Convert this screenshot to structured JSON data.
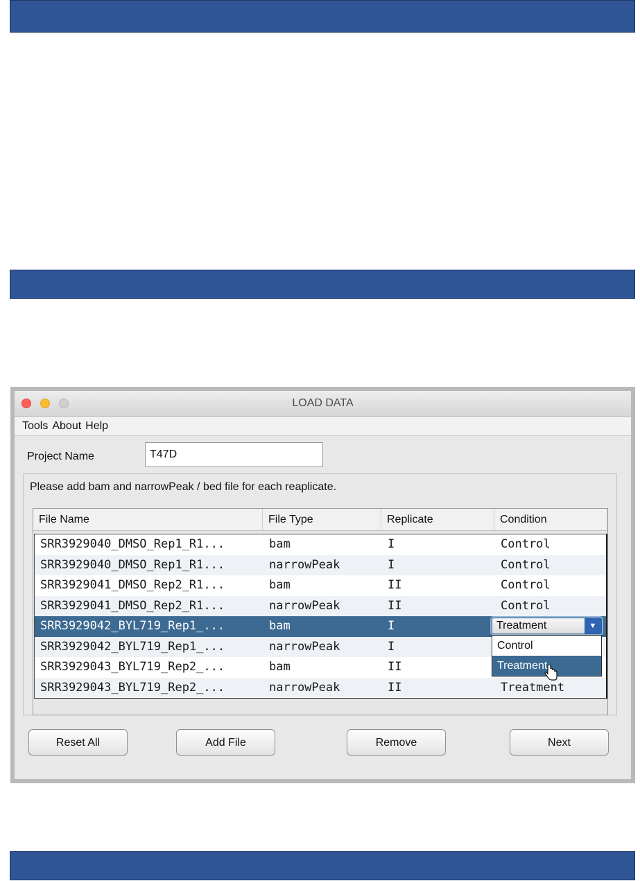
{
  "window": {
    "title": "LOAD DATA"
  },
  "menu": [
    "Tools",
    "About",
    "Help"
  ],
  "project": {
    "label": "Project Name",
    "value": "T47D"
  },
  "instructions": "Please add bam and narrowPeak / bed file for each reaplicate.",
  "table": {
    "headers": [
      "File Name",
      "File Type",
      "Replicate",
      "Condition"
    ],
    "rows": [
      [
        "SRR3929040_DMSO_Rep1_R1...",
        "bam",
        "I",
        "Control"
      ],
      [
        "SRR3929040_DMSO_Rep1_R1...",
        "narrowPeak",
        "I",
        "Control"
      ],
      [
        "SRR3929041_DMSO_Rep2_R1...",
        "bam",
        "II",
        "Control"
      ],
      [
        "SRR3929041_DMSO_Rep2_R1...",
        "narrowPeak",
        "II",
        "Control"
      ],
      [
        "SRR3929042_BYL719_Rep1_...",
        "bam",
        "I",
        ""
      ],
      [
        "SRR3929042_BYL719_Rep1_...",
        "narrowPeak",
        "I",
        ""
      ],
      [
        "SRR3929043_BYL719_Rep2_...",
        "bam",
        "II",
        ""
      ],
      [
        "SRR3929043_BYL719_Rep2_...",
        "narrowPeak",
        "II",
        "Treatment"
      ]
    ],
    "selected_row": 4
  },
  "condition_combo": {
    "value": "Treatment",
    "options": [
      "Control",
      "Treatment"
    ],
    "highlighted": "Treatment"
  },
  "buttons": {
    "reset": "Reset All",
    "add": "Add File",
    "remove": "Remove",
    "next": "Next"
  },
  "colors": {
    "band": "#2f5597",
    "selection": "#3c6a92"
  },
  "icons": {
    "cursor": "hand-pointer-icon",
    "combo_arrow": "chevron-down-icon"
  }
}
